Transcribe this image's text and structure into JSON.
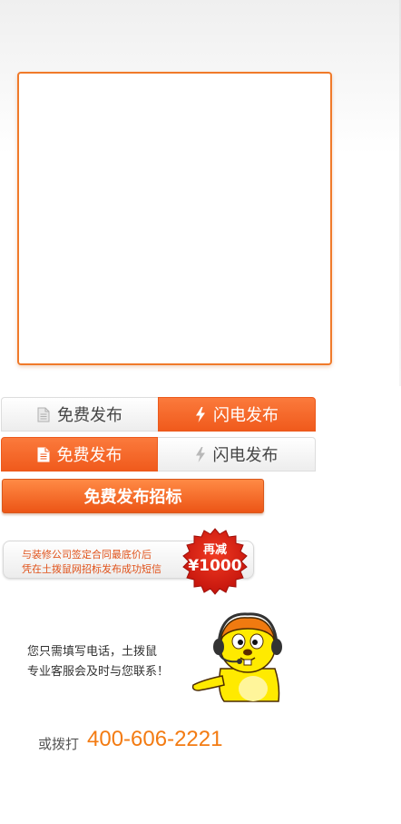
{
  "tabs_row1": {
    "free_publish_label": "免费发布",
    "flash_publish_label": "闪电发布",
    "active": "flash"
  },
  "tabs_row2": {
    "free_publish_label": "免费发布",
    "flash_publish_label": "闪电发布",
    "active": "free"
  },
  "submit": {
    "label": "免费发布招标"
  },
  "promo": {
    "line1": "与装修公司签定合同最底价后",
    "line2": "凭在土拨鼠网招标发布成功短信",
    "badge_top": "再减",
    "badge_amount": "¥1000"
  },
  "contact": {
    "line1": "您只需填写电话，土拨鼠",
    "line2": "专业客服会及时与您联系！",
    "phone_prefix": "或拨打",
    "phone_number": "400-606-2221"
  },
  "colors": {
    "accent": "#f05a1c",
    "phone": "#f37b12",
    "badge": "#d81d10",
    "mascot_yellow": "#ffea00"
  },
  "icons": {
    "free_publish": "document-icon",
    "flash_publish": "lightning-icon",
    "mascot": "groundhog-headset-mascot"
  }
}
